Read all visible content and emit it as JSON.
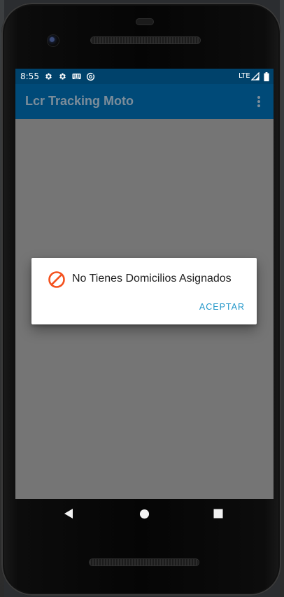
{
  "status_bar": {
    "time": "8:55",
    "network": "LTE",
    "icons": [
      "settings-gear-icon",
      "settings-gear-icon",
      "keyboard-icon",
      "sync-icon",
      "signal-icon",
      "battery-icon"
    ]
  },
  "app_bar": {
    "title": "Lcr Tracking Moto",
    "menu_icon": "more-vert-icon"
  },
  "dialog": {
    "icon": "block-icon",
    "message": "No Tienes Domicilios Asignados",
    "button_label": "ACEPTAR"
  },
  "nav_bar": {
    "buttons": [
      "back-icon",
      "home-icon",
      "recents-icon"
    ]
  },
  "colors": {
    "status_bar": "#00426b",
    "app_bar": "#004a78",
    "scrim": "#757575",
    "accent": "#2196c9",
    "block_icon": "#f4511e"
  }
}
